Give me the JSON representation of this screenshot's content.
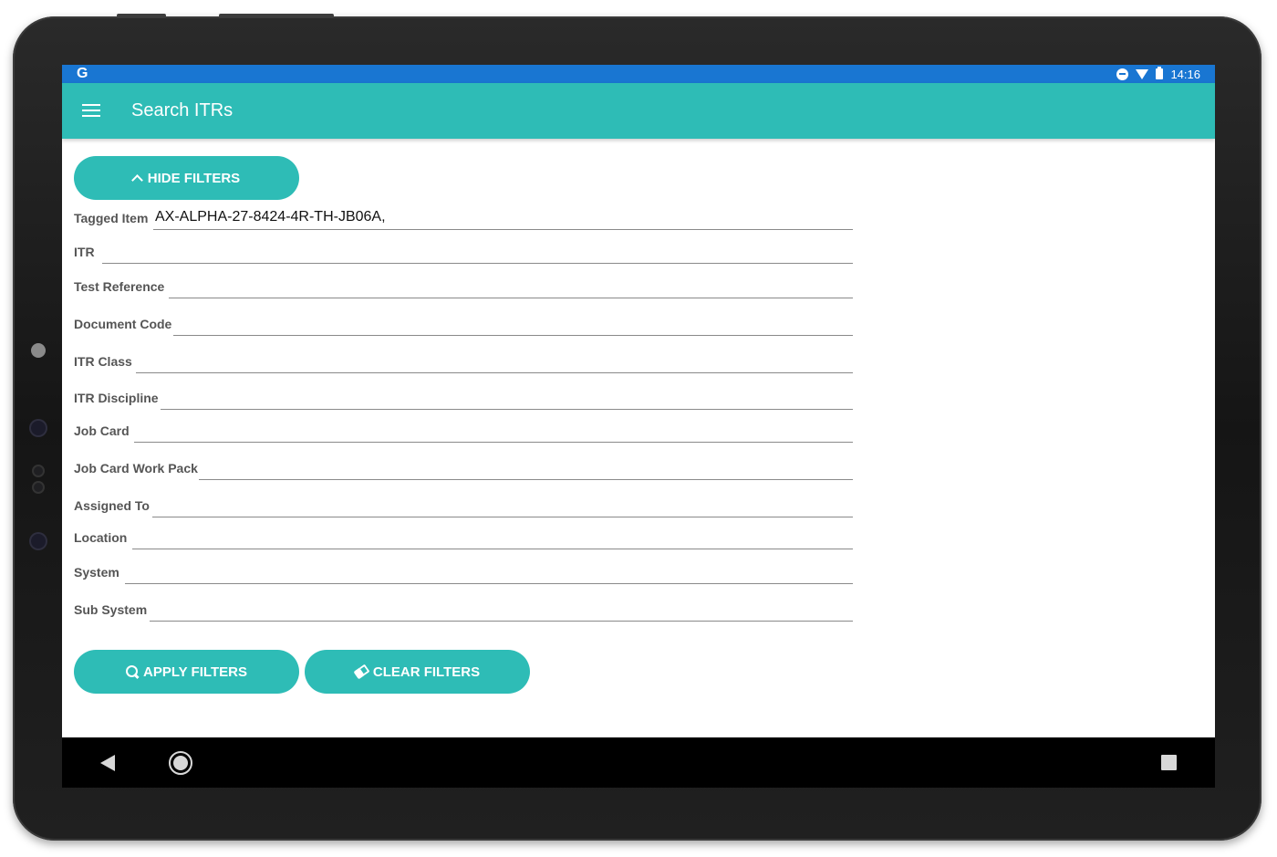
{
  "status_bar": {
    "app_icon": "G",
    "time": "14:16",
    "icons": [
      "do-not-disturb-icon",
      "wifi-icon",
      "battery-icon"
    ]
  },
  "app_bar": {
    "title": "Search ITRs",
    "menu_icon": "hamburger-menu-icon"
  },
  "filters": {
    "hide_label": "HIDE FILTERS",
    "apply_label": "APPLY FILTERS",
    "clear_label": "CLEAR FILTERS",
    "fields": {
      "tagged_item": {
        "label": "Tagged Item",
        "value": "AX-ALPHA-27-8424-4R-TH-JB06A,"
      },
      "itr": {
        "label": "ITR",
        "value": ""
      },
      "test_reference": {
        "label": "Test Reference",
        "value": ""
      },
      "document_code": {
        "label": "Document Code",
        "value": ""
      },
      "itr_class": {
        "label": "ITR Class",
        "value": ""
      },
      "itr_discipline": {
        "label": "ITR Discipline",
        "value": ""
      },
      "job_card": {
        "label": "Job Card",
        "value": ""
      },
      "job_card_work_pack": {
        "label": "Job Card Work Pack",
        "value": ""
      },
      "assigned_to": {
        "label": "Assigned To",
        "value": ""
      },
      "location": {
        "label": "Location",
        "value": ""
      },
      "system": {
        "label": "System",
        "value": ""
      },
      "sub_system": {
        "label": "Sub System",
        "value": ""
      }
    }
  },
  "colors": {
    "status_bar": "#1976d2",
    "accent": "#2ebcb6",
    "nav_bar": "#000000"
  }
}
